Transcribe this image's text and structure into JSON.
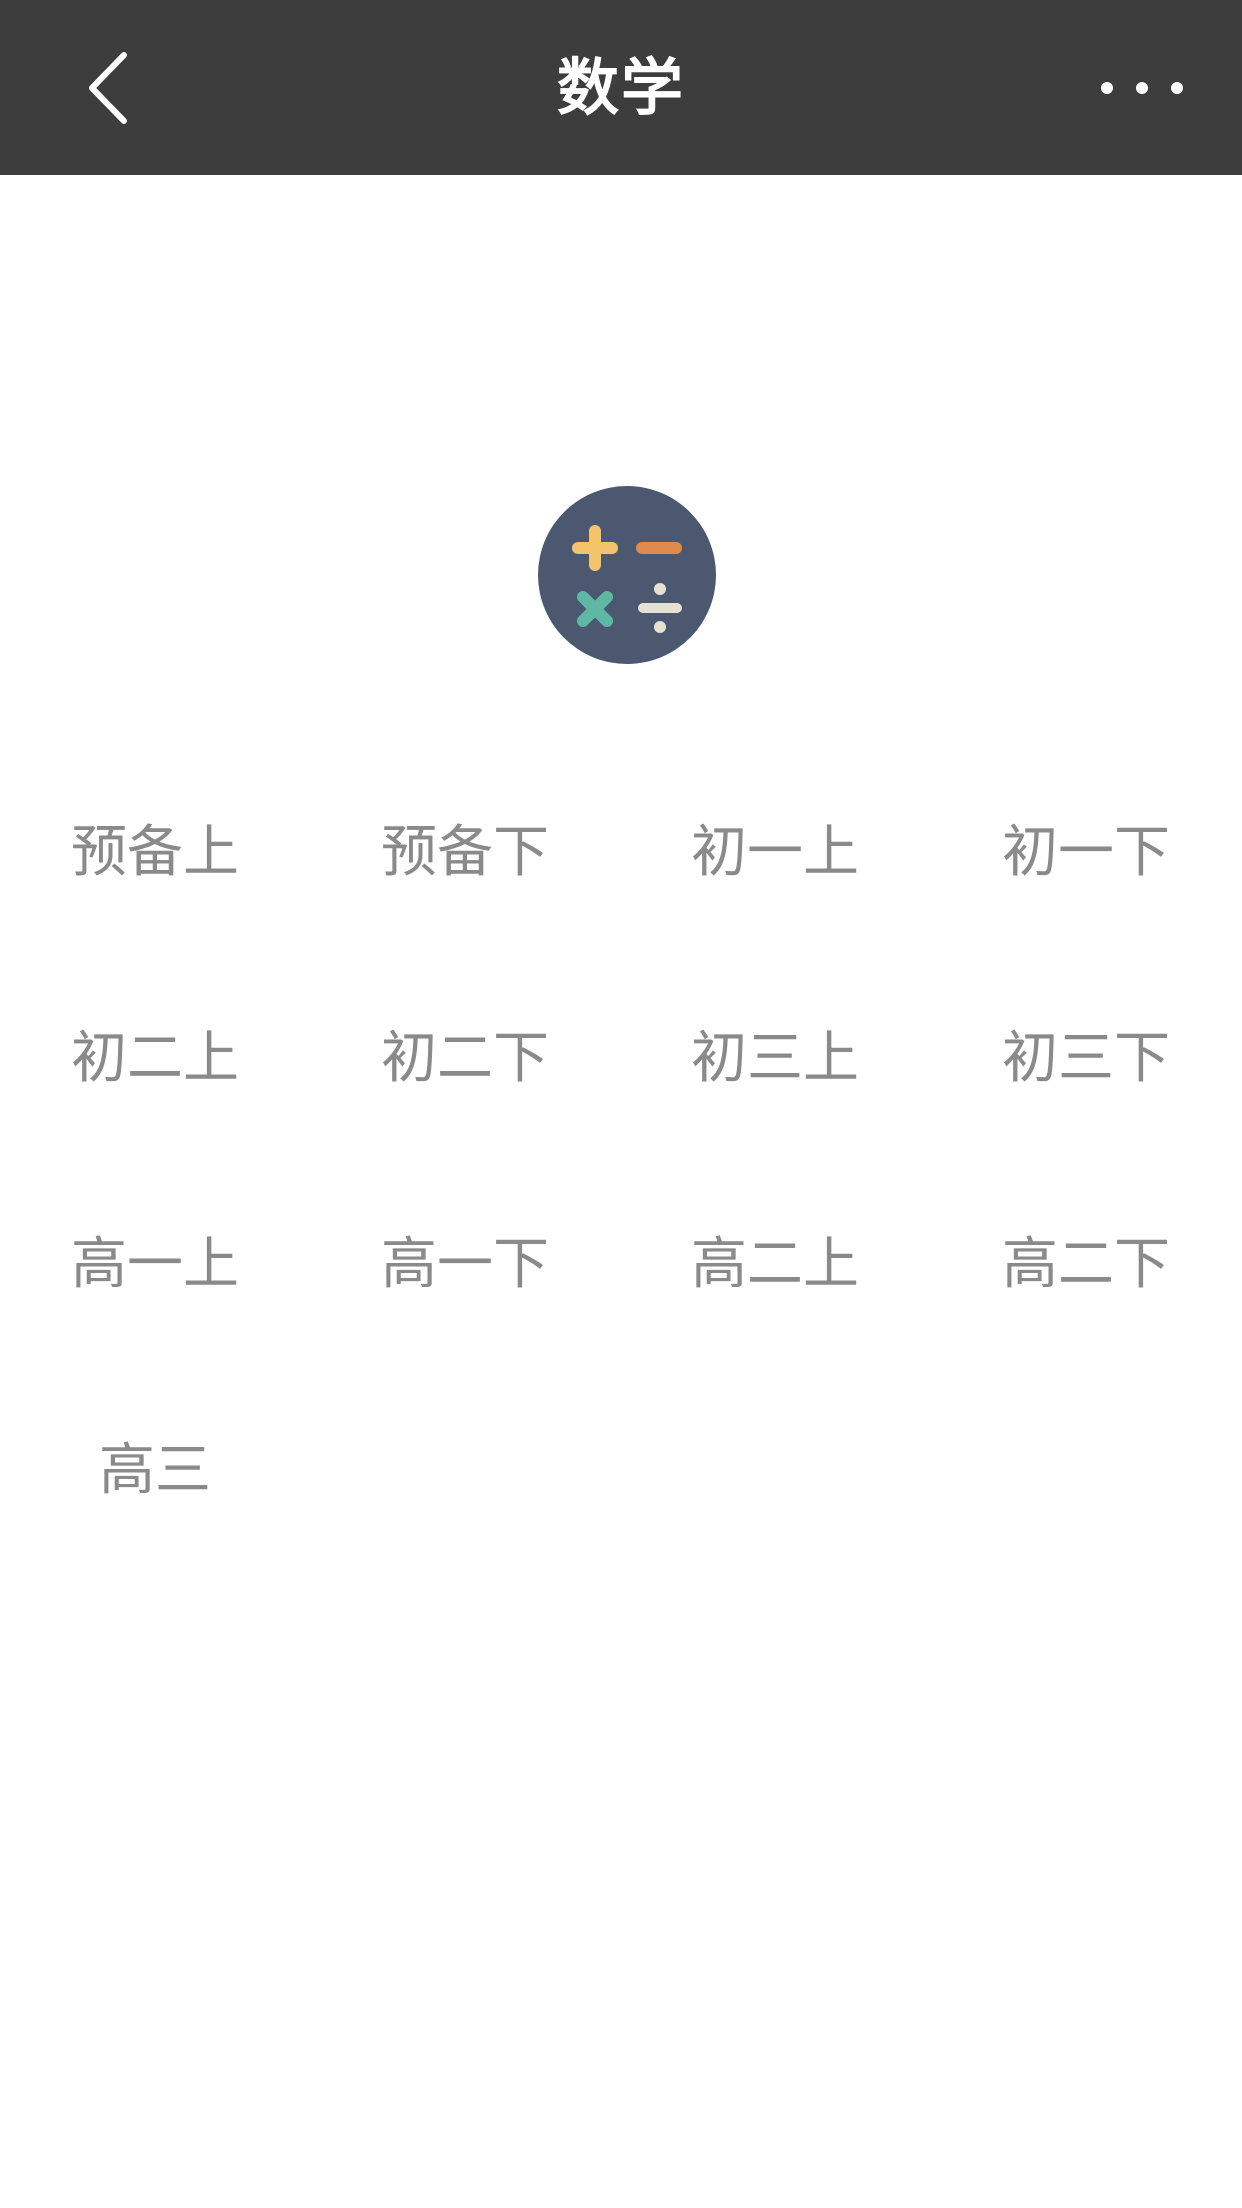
{
  "header": {
    "title": "数学"
  },
  "colors": {
    "navbar_bg": "#3d3d3d",
    "icon_circle": "#4c5870",
    "plus": "#f3c46a",
    "minus": "#e08b4e",
    "times": "#5fb8a4",
    "divide": "#e6e1d2",
    "grade_text": "#8a8a8a"
  },
  "icons": {
    "back": "chevron-left-icon",
    "more": "more-dots-icon",
    "subject": "math-calculator-icon"
  },
  "grades": [
    {
      "label": "预备上"
    },
    {
      "label": "预备下"
    },
    {
      "label": "初一上"
    },
    {
      "label": "初一下"
    },
    {
      "label": "初二上"
    },
    {
      "label": "初二下"
    },
    {
      "label": "初三上"
    },
    {
      "label": "初三下"
    },
    {
      "label": "高一上"
    },
    {
      "label": "高一下"
    },
    {
      "label": "高二上"
    },
    {
      "label": "高二下"
    },
    {
      "label": "高三"
    }
  ]
}
